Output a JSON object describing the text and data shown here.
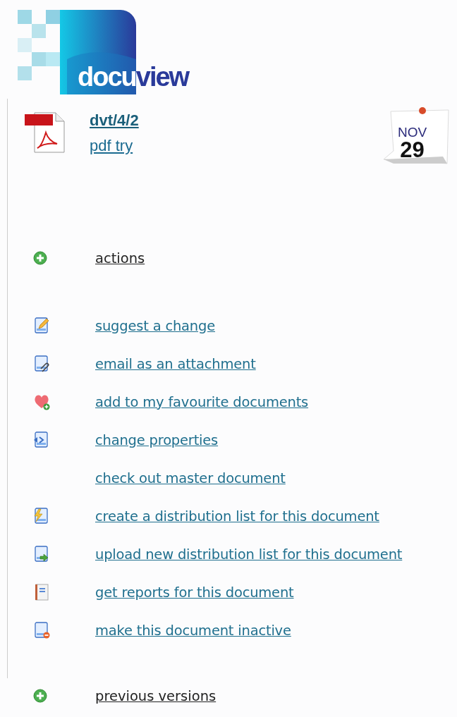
{
  "logo": {
    "part_1": "docu",
    "part_2": "view"
  },
  "document": {
    "reference": "dvt/4/2",
    "title": "pdf try",
    "date": {
      "month": "NOV",
      "day": "29"
    }
  },
  "sections": [
    {
      "label": "actions",
      "expanded": false,
      "items": [
        {
          "label": "suggest a change",
          "kind": "pencil"
        },
        {
          "label": "email as an attachment",
          "kind": "attach"
        },
        {
          "label": "add to my favourite documents",
          "kind": "heart"
        },
        {
          "label": "change properties",
          "kind": "properties"
        },
        {
          "label": "check out master document",
          "kind": "none"
        },
        {
          "label": "create a distribution list for this document",
          "kind": "lightning"
        },
        {
          "label": "upload new distribution list for this document",
          "kind": "upload"
        },
        {
          "label": "get reports for this document",
          "kind": "report"
        },
        {
          "label": "make this document inactive",
          "kind": "remove"
        }
      ]
    },
    {
      "label": "previous versions",
      "expanded": false
    }
  ]
}
